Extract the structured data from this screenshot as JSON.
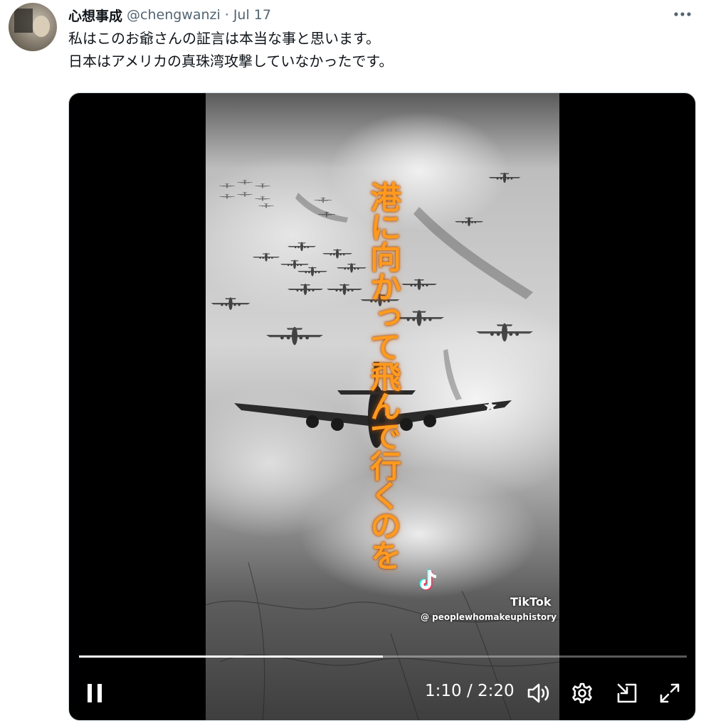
{
  "tweet": {
    "display_name": "心想事成",
    "handle": "@chengwanzi",
    "separator": "·",
    "date": "Jul 17",
    "text_lines": [
      "私はこのお爺さんの証言は本当な事と思います。",
      "日本はアメリカの真珠湾攻撃していなかったです。"
    ]
  },
  "video": {
    "overlay_text": "港に向かって飛んで行くのを",
    "watermark_brand": "TikTok",
    "watermark_user": "@ peoplewhomakeuphistory",
    "current_time": "1:10",
    "time_separator": "/",
    "duration": "2:20",
    "progress_fraction": 0.5
  },
  "icons": {
    "more": "more-horizontal-icon",
    "pause": "pause-icon",
    "volume": "volume-icon",
    "settings": "gear-icon",
    "pop_out": "pop-out-icon",
    "fullscreen": "fullscreen-icon"
  },
  "colors": {
    "overlay_text": "#ff9a1f",
    "handle": "#536471",
    "player_bg": "#000000"
  }
}
